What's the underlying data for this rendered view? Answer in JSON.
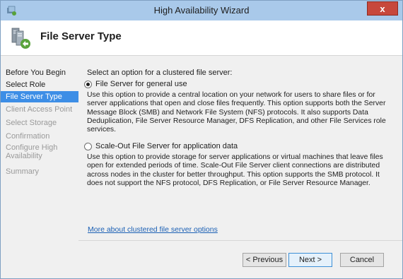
{
  "window": {
    "title": "High Availability Wizard",
    "close_label": "x",
    "icon": "wizard-app-icon"
  },
  "header": {
    "title": "File Server Type",
    "icon": "file-server-cluster-icon"
  },
  "steps": [
    {
      "label": "Before You Begin",
      "state": "normal"
    },
    {
      "label": "Select Role",
      "state": "normal"
    },
    {
      "label": "File Server Type",
      "state": "active"
    },
    {
      "label": "Client Access Point",
      "state": "disabled"
    },
    {
      "label": "Select Storage",
      "state": "disabled"
    },
    {
      "label": "Confirmation",
      "state": "disabled"
    },
    {
      "label": "Configure High Availability",
      "state": "disabled"
    },
    {
      "label": "Summary",
      "state": "disabled"
    }
  ],
  "main": {
    "prompt": "Select an option for a clustered file server:",
    "options": [
      {
        "label": "File Server for general use",
        "selected": true,
        "description": "Use this option to provide a central location on your network for users to share files or for server applications that open and close files frequently. This option supports both the Server Message Block (SMB) and Network File System (NFS) protocols. It also supports Data Deduplication, File Server Resource Manager, DFS Replication, and other File Services role services."
      },
      {
        "label": "Scale-Out File Server for application data",
        "selected": false,
        "description": "Use this option to provide storage for server applications or virtual machines that leave files open for extended periods of time. Scale-Out File Server client connections are distributed across nodes in the cluster for better throughput. This option supports the SMB protocol. It does not support the NFS protocol, DFS Replication, or File Server Resource Manager."
      }
    ],
    "link": "More about clustered file server options"
  },
  "footer": {
    "previous": "< Previous",
    "next": "Next >",
    "cancel": "Cancel"
  }
}
